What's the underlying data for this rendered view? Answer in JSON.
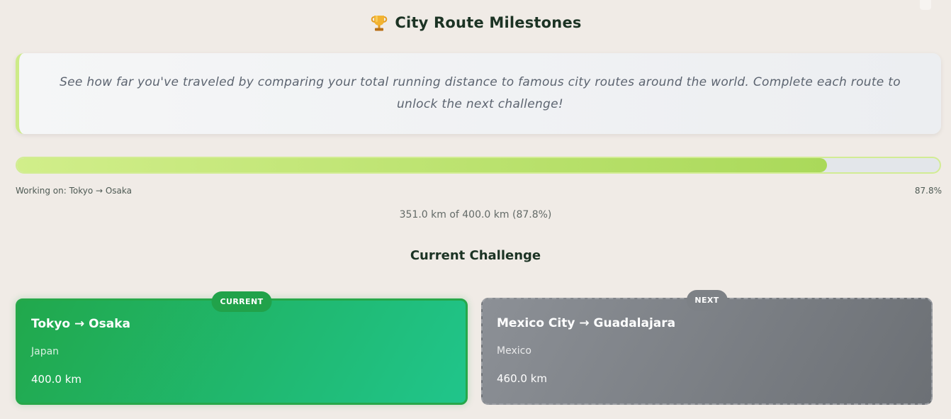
{
  "page": {
    "title": "City Route Milestones",
    "trophy_icon": "trophy-icon"
  },
  "intro": {
    "text": "See how far you've traveled by comparing your total running distance to famous city routes around the world. Complete each route to unlock the next challenge!"
  },
  "progress": {
    "fraction": 0.878,
    "working_on": "Working on: Tokyo → Osaka",
    "percent_label": "87.8%",
    "summary": "351.0 km of 400.0 km (87.8%)"
  },
  "section": {
    "title": "Current Challenge"
  },
  "routes": [
    {
      "badge": "CURRENT",
      "name": "Tokyo → Osaka",
      "country": "Japan",
      "distance": "400.0 km"
    },
    {
      "badge": "NEXT",
      "name": "Mexico City → Guadalajara",
      "country": "Mexico",
      "distance": "460.0 km"
    }
  ],
  "colors": {
    "background": "#f0ebe6",
    "title": "#1c3324",
    "progress_fill": "#aad95a",
    "current_card": "#21a84c",
    "next_card": "#7d8186"
  }
}
